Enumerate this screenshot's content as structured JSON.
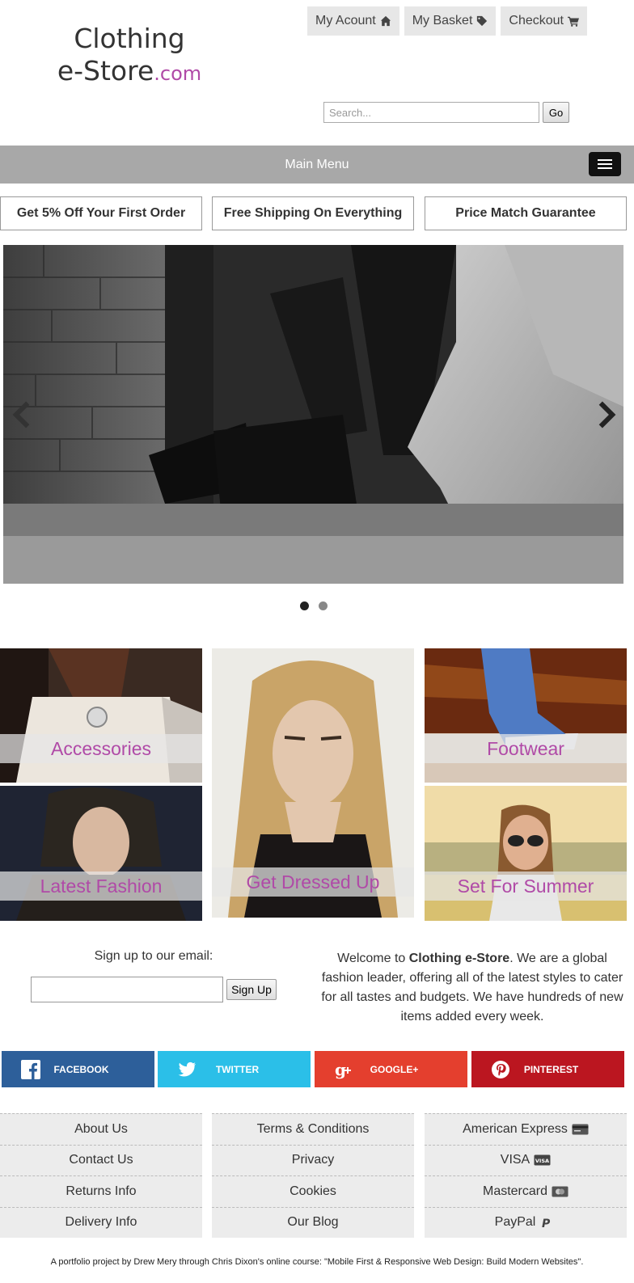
{
  "logo": {
    "line1": "Clothing",
    "line2": "e-Store",
    "suffix": ".com"
  },
  "header": {
    "buttons": [
      {
        "label": "My Acount",
        "icon": "home-icon"
      },
      {
        "label": "My Basket",
        "icon": "tag-icon"
      },
      {
        "label": "Checkout",
        "icon": "cart-icon"
      }
    ],
    "search": {
      "placeholder": "Search...",
      "go_label": "Go"
    }
  },
  "menu": {
    "label": "Main Menu",
    "icon": "hamburger-icon"
  },
  "promos": [
    "Get 5% Off Your First Order",
    "Free Shipping On Everything",
    "Price Match Guarantee"
  ],
  "slider": {
    "slide_count": 2,
    "active_slide": 1
  },
  "categories": [
    {
      "label": "Accessories"
    },
    {
      "label": "Get Dressed Up"
    },
    {
      "label": "Footwear"
    },
    {
      "label": "Latest Fashion"
    },
    {
      "label": "Set For Summer"
    }
  ],
  "signup": {
    "label": "Sign up to our email:",
    "button": "Sign Up",
    "value": ""
  },
  "welcome": {
    "pre": "Welcome to ",
    "brand": "Clothing e-Store",
    "post": ". We are a global fashion leader, offering all of the latest styles to cater for all tastes and budgets. We have hundreds of new items added every week."
  },
  "social": [
    {
      "label": "FACEBOOK",
      "icon": "facebook-icon",
      "color": "#2d5f9a"
    },
    {
      "label": "TWITTER",
      "icon": "twitter-icon",
      "color": "#2bbfe8"
    },
    {
      "label": "GOOGLE+",
      "icon": "google-plus-icon",
      "color": "#e43f2e"
    },
    {
      "label": "PINTEREST",
      "icon": "pinterest-icon",
      "color": "#bb1620"
    }
  ],
  "footer": {
    "info": [
      "About Us",
      "Contact Us",
      "Returns Info",
      "Delivery Info"
    ],
    "policies": [
      "Terms & Conditions",
      "Privacy",
      "Cookies",
      "Our Blog"
    ],
    "payments": [
      {
        "label": "American Express",
        "icon": "credit-card-icon"
      },
      {
        "label": "VISA",
        "icon": "visa-card-icon"
      },
      {
        "label": "Mastercard",
        "icon": "mastercard-icon"
      },
      {
        "label": "PayPal",
        "icon": "paypal-icon"
      }
    ]
  },
  "credit": "A portfolio project by Drew Mery through Chris Dixon's online course: \"Mobile First & Responsive Web Design: Build Modern Websites\".",
  "colors": {
    "accent": "#b04aa7",
    "menu_bar": "#a8a8a8"
  }
}
